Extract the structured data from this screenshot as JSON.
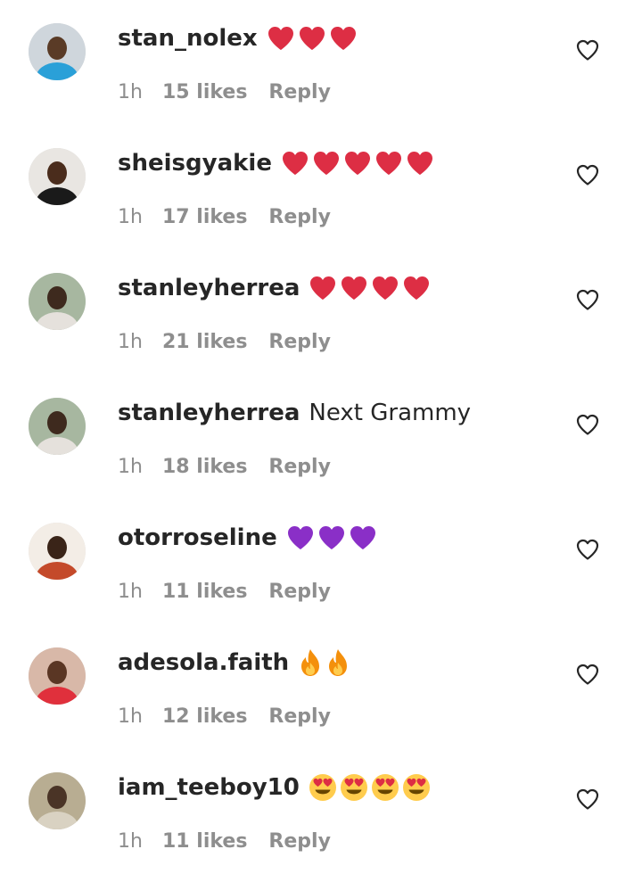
{
  "comments": [
    {
      "username": "stan_nolex",
      "text": "",
      "emojis": [
        "red-heart",
        "red-heart",
        "red-heart"
      ],
      "time": "1h",
      "likes": "15 likes",
      "reply": "Reply",
      "avatar_colors": {
        "bg": "#cfd6dc",
        "body": "#2aa0d8",
        "skin": "#5a3b26"
      }
    },
    {
      "username": "sheisgyakie",
      "text": "",
      "emojis": [
        "red-heart",
        "red-heart",
        "red-heart",
        "red-heart",
        "red-heart"
      ],
      "time": "1h",
      "likes": "17 likes",
      "reply": "Reply",
      "avatar_colors": {
        "bg": "#e9e6e2",
        "body": "#1a1a1a",
        "skin": "#4a2c1c"
      }
    },
    {
      "username": "stanleyherrea",
      "text": "",
      "emojis": [
        "red-heart",
        "red-heart",
        "red-heart",
        "red-heart"
      ],
      "time": "1h",
      "likes": "21 likes",
      "reply": "Reply",
      "avatar_colors": {
        "bg": "#a7b7a0",
        "body": "#e5e1dc",
        "skin": "#3e2a1e"
      }
    },
    {
      "username": "stanleyherrea",
      "text": "Next Grammy",
      "emojis": [],
      "time": "1h",
      "likes": "18 likes",
      "reply": "Reply",
      "avatar_colors": {
        "bg": "#a7b7a0",
        "body": "#e5e1dc",
        "skin": "#3e2a1e"
      }
    },
    {
      "username": "otorroseline",
      "text": "",
      "emojis": [
        "purple-heart",
        "purple-heart",
        "purple-heart"
      ],
      "time": "1h",
      "likes": "11 likes",
      "reply": "Reply",
      "avatar_colors": {
        "bg": "#f3ede6",
        "body": "#c44a2a",
        "skin": "#3a2418"
      }
    },
    {
      "username": "adesola.faith",
      "text": "",
      "emojis": [
        "fire",
        "fire"
      ],
      "time": "1h",
      "likes": "12 likes",
      "reply": "Reply",
      "avatar_colors": {
        "bg": "#d8b8a8",
        "body": "#e0303c",
        "skin": "#5a3624"
      }
    },
    {
      "username": "iam_teeboy10",
      "text": "",
      "emojis": [
        "heart-eyes",
        "heart-eyes",
        "heart-eyes",
        "heart-eyes"
      ],
      "time": "1h",
      "likes": "11 likes",
      "reply": "Reply",
      "avatar_colors": {
        "bg": "#b8ad92",
        "body": "#d9d2c2",
        "skin": "#4a3426"
      }
    }
  ],
  "colors": {
    "username": "#262626",
    "meta": "#8e8e8e",
    "like_icon": "#262626",
    "red_heart": "#dd2e44",
    "purple_heart": "#8a2fc7",
    "fire": "#f4900c",
    "emoji_face": "#ffcc4d"
  }
}
